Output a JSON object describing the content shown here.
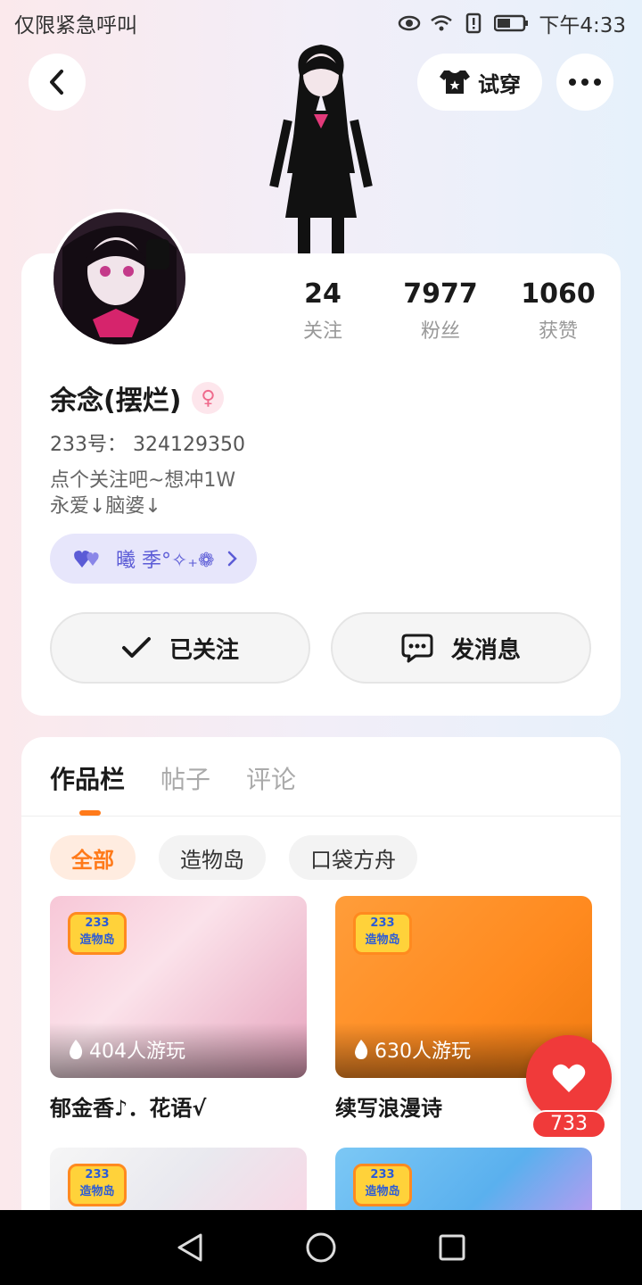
{
  "status_bar": {
    "carrier": "仅限紧急呼叫",
    "time": "下午4:33"
  },
  "header": {
    "try_on_label": "试穿"
  },
  "profile": {
    "stats": [
      {
        "num": "24",
        "label": "关注"
      },
      {
        "num": "7977",
        "label": "粉丝"
      },
      {
        "num": "1060",
        "label": "获赞"
      }
    ],
    "username": "余念(摆烂)",
    "gender_symbol": "♀",
    "uid": "233号：  324129350",
    "bio_line1": "点个关注吧~想冲1W",
    "bio_line2": "永爱↓脑婆↓",
    "family_name": "曦 季°✧₊❁",
    "follow_label": "已关注",
    "message_label": "发消息"
  },
  "works": {
    "tabs": [
      "作品栏",
      "帖子",
      "评论"
    ],
    "chips": [
      "全部",
      "造物岛",
      "口袋方舟"
    ],
    "items": [
      {
        "title": "郁金香♪．花语√",
        "plays": "404人游玩",
        "badge_top": "233",
        "badge_bottom": "造物岛"
      },
      {
        "title": "续写浪漫诗",
        "plays": "630人游玩",
        "badge_top": "233",
        "badge_bottom": "造物岛"
      },
      {
        "badge_top": "233",
        "badge_bottom": "造物岛"
      },
      {
        "badge_top": "233",
        "badge_bottom": "造物岛"
      }
    ]
  },
  "like": {
    "count": "733"
  },
  "colors": {
    "accent": "#ff7a1a",
    "like_red": "#f03a3a",
    "family_purple": "#5b5bd6"
  }
}
